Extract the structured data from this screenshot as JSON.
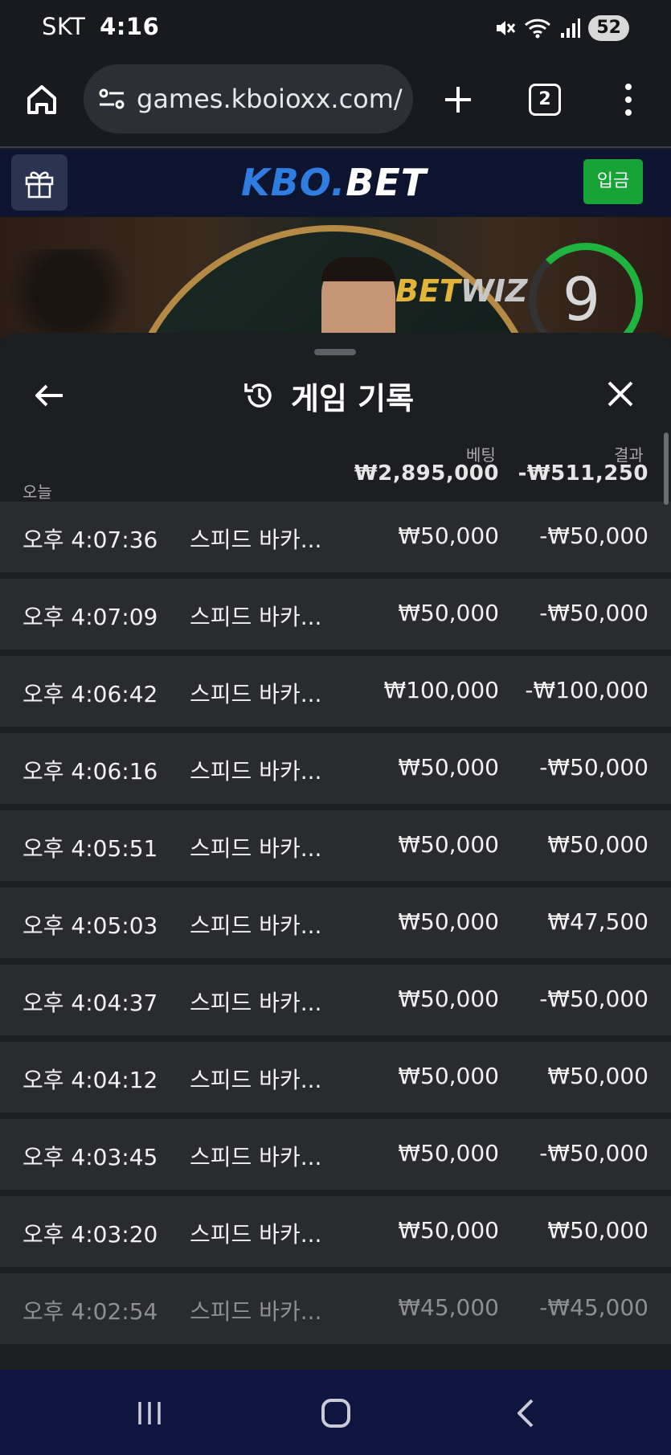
{
  "status_bar": {
    "carrier": "SKT",
    "time": "4:16",
    "battery": "52",
    "icons": [
      "mute-icon",
      "wifi-icon",
      "signal-icon"
    ]
  },
  "browser": {
    "url": "games.kboioxx.com/",
    "tab_count": "2",
    "icons": [
      "home-icon",
      "site-info-icon",
      "plus-icon",
      "menu-icon"
    ]
  },
  "site_header": {
    "logo_kbo": "KBO.",
    "logo_bet": "BET",
    "login_label": "입금",
    "gift_icon": "gift-icon"
  },
  "video": {
    "brand_bet": "BET",
    "brand_wiz": "WIZ",
    "timer": "9"
  },
  "sheet": {
    "title": "게임 기록",
    "history_icon": "history-icon",
    "back_icon": "arrow-left-icon",
    "close_icon": "close-icon",
    "summary": {
      "label": "오늘",
      "bet_header": "베팅",
      "result_header": "결과",
      "bet_total": "₩2,895,000",
      "result_total": "-₩511,250"
    },
    "rows": [
      {
        "time": "오후 4:07:36",
        "game": "스피드 바카...",
        "bet": "₩50,000",
        "result": "-₩50,000"
      },
      {
        "time": "오후 4:07:09",
        "game": "스피드 바카...",
        "bet": "₩50,000",
        "result": "-₩50,000"
      },
      {
        "time": "오후 4:06:42",
        "game": "스피드 바카...",
        "bet": "₩100,000",
        "result": "-₩100,000"
      },
      {
        "time": "오후 4:06:16",
        "game": "스피드 바카...",
        "bet": "₩50,000",
        "result": "-₩50,000"
      },
      {
        "time": "오후 4:05:51",
        "game": "스피드 바카...",
        "bet": "₩50,000",
        "result": "₩50,000"
      },
      {
        "time": "오후 4:05:03",
        "game": "스피드 바카...",
        "bet": "₩50,000",
        "result": "₩47,500"
      },
      {
        "time": "오후 4:04:37",
        "game": "스피드 바카...",
        "bet": "₩50,000",
        "result": "-₩50,000"
      },
      {
        "time": "오후 4:04:12",
        "game": "스피드 바카...",
        "bet": "₩50,000",
        "result": "₩50,000"
      },
      {
        "time": "오후 4:03:45",
        "game": "스피드 바카...",
        "bet": "₩50,000",
        "result": "-₩50,000"
      },
      {
        "time": "오후 4:03:20",
        "game": "스피드 바카...",
        "bet": "₩50,000",
        "result": "₩50,000"
      },
      {
        "time": "오후 4:02:54",
        "game": "스피드 바카...",
        "bet": "₩45,000",
        "result": "-₩45,000"
      }
    ]
  },
  "nav_bar": {
    "icons": [
      "recents-icon",
      "home-button-icon",
      "back-icon"
    ]
  },
  "colors": {
    "login_green": "#18a336",
    "logo_blue": "#2f7de1",
    "timer_green": "#1fb43e"
  }
}
